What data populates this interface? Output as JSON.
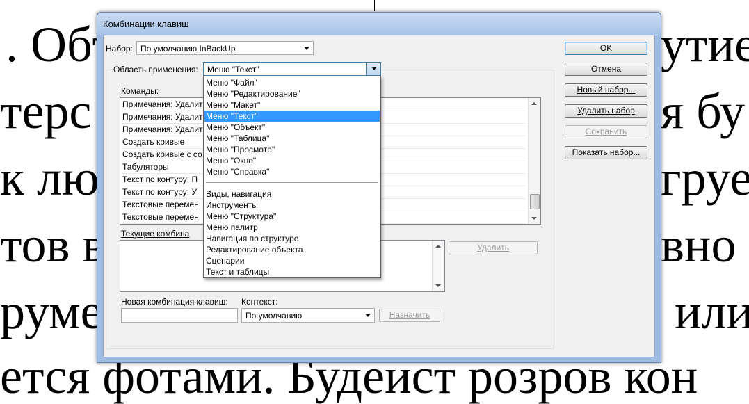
{
  "background": {
    "lines": [
      ". Обт",
      "утие",
      "терс",
      "я бу",
      "к лю",
      "груе",
      "тов в",
      "вно",
      "руме",
      "или",
      "ется фотами. Будеист розров кон"
    ]
  },
  "dialog": {
    "title": "Комбинации клавиш",
    "set_label": "Набор:",
    "set_value": "По умолчанию InBackUp",
    "scope_label": "Область применения:",
    "scope_value": "Меню \"Текст\"",
    "commands_label": "Команды:",
    "commands": [
      "Примечания: Удалить",
      "Примечания: Удалить",
      "Примечания: Удалить",
      "Создать кривые",
      "Создать кривые с со",
      "Табуляторы",
      "Текст по контуру: П",
      "Текст по контуру: У",
      "Текстовые перемен",
      "Текстовые перемен"
    ],
    "current_label": "Текущие комбина",
    "delete_button": "Удалить",
    "new_combo_label": "Новая комбинация клавиш:",
    "context_label": "Контекст:",
    "context_value": "По умолчанию",
    "assign_button": "Назначить",
    "buttons": {
      "ok": "OK",
      "cancel": "Отмена",
      "new_set": "Новый набор...",
      "delete_set": "Удалить набор",
      "save": "Сохранить",
      "show_set": "Показать набор..."
    }
  },
  "dropdown": {
    "items_top": [
      "Меню \"Файл\"",
      "Меню \"Редактирование\"",
      "Меню \"Макет\"",
      "Меню \"Текст\"",
      "Меню \"Объект\"",
      "Меню \"Таблица\"",
      "Меню \"Просмотр\"",
      "Меню \"Окно\"",
      "Меню \"Справка\""
    ],
    "items_bottom": [
      "Виды, навигация",
      "Инструменты",
      "Меню \"Структура\"",
      "Меню палитр",
      "Навигация по структуре",
      "Редактирование объекта",
      "Сценарии",
      "Текст и таблицы"
    ],
    "selected_index": 3,
    "selection_color": "#3399ff"
  }
}
